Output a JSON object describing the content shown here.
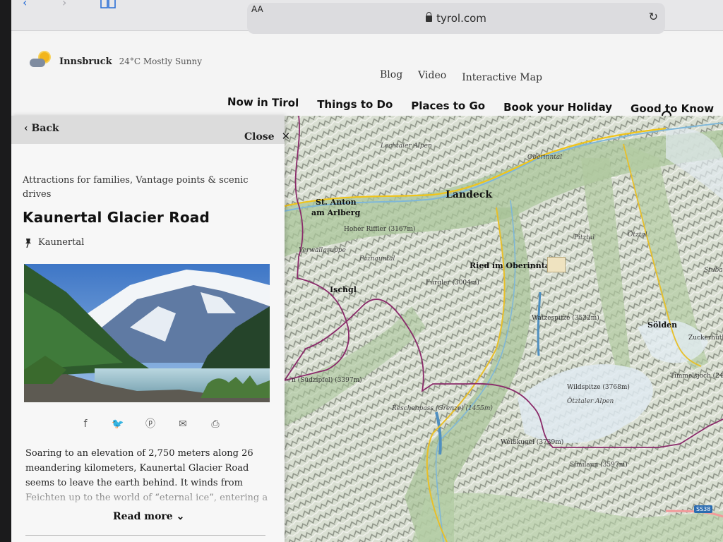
{
  "browser": {
    "url": "tyrol.com",
    "text_size_label": "AA"
  },
  "header": {
    "weather": {
      "city": "Innsbruck",
      "condition": "24°C Mostly Sunny"
    },
    "util_nav": [
      "Blog",
      "Video",
      "Interactive Map"
    ],
    "main_nav": [
      "Now in Tirol",
      "Things to Do",
      "Places to Go",
      "Book your Holiday",
      "Good to Know"
    ]
  },
  "panel": {
    "back_label": "Back",
    "close_label": "Close",
    "categories": "Attractions for families, Vantage points & scenic drives",
    "title": "Kaunertal Glacier Road",
    "location": "Kaunertal",
    "share_icons": [
      "facebook-icon",
      "twitter-icon",
      "pinterest-icon",
      "email-icon",
      "print-icon"
    ],
    "description": "Soaring to an elevation of 2,750 meters along 26 meandering kilometers, Kaunertal Glacier Road seems to leave the earth behind. It winds from Feichten up to the world of “eternal ice”, entering a",
    "read_more": "Read more"
  },
  "map": {
    "labels": {
      "lechtaler": "Lechtaler Alpen",
      "oberinntal": "Oberinntal",
      "landeck": "Landeck",
      "st_anton_1": "St. Anton",
      "st_anton_2": "am Arlberg",
      "hoher_riffler": "Hoher Riffler (3167m)",
      "verwall": "Verwallgruppe",
      "paznauntal": "Paznauntal",
      "pitztal": "Pitztal",
      "otztal": "Ötztal",
      "stubaier": "Stubaier",
      "ried": "Ried im Oberinntal",
      "furgler": "Furgler (3004m)",
      "ischgl": "Ischgl",
      "watzespitze": "Watzespitze (3532m)",
      "solden": "Sölden",
      "zuckerhutl": "Zuckerhütl",
      "sudzipfel": "n (Südzipfel) (3397m)",
      "wildspitze": "Wildspitze (3768m)",
      "otztaler_alpen": "Ötztaler Alpen",
      "timmelsjoch": "Timmelsjoch (2474m)",
      "reschenpass": "Reschenpass (Grenze) (1455m)",
      "weisskugel": "Weißkugel (3739m)",
      "similaun": "Similaun (3597m)",
      "ss38": "SS38"
    }
  }
}
